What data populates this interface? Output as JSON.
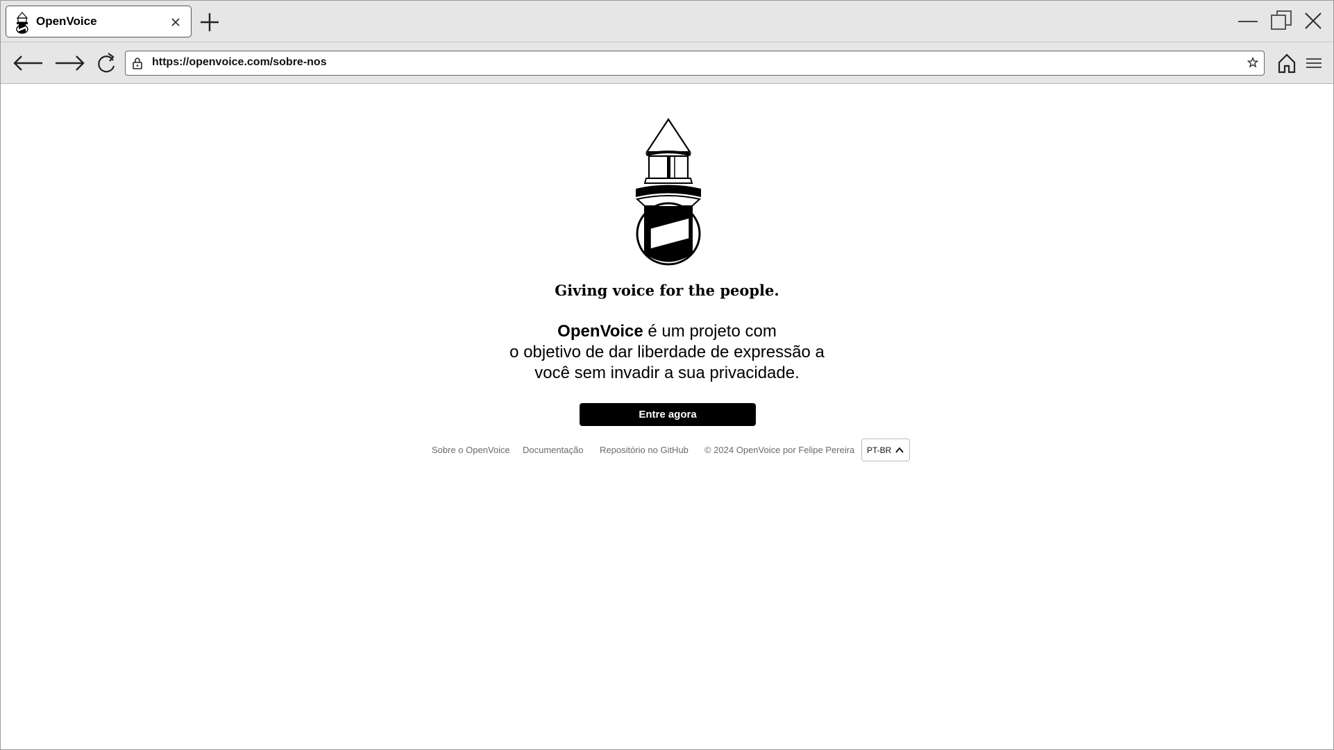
{
  "browser": {
    "tab": {
      "title": "OpenVoice",
      "favicon": "lighthouse-icon"
    },
    "url": "https://openvoice.com/sobre-nos",
    "icons": [
      "back-arrow-icon",
      "forward-arrow-icon",
      "reload-icon",
      "lock-icon",
      "star-icon",
      "home-icon",
      "menu-icon",
      "minimize-icon",
      "maximize-icon",
      "close-icon",
      "plus-icon"
    ]
  },
  "page": {
    "logo": "lighthouse-icon",
    "tagline": "Giving voice for the people.",
    "intro": {
      "brand": "OpenVoice",
      "line1_rest": " é um projeto com",
      "line2": "o objetivo de dar liberdade de expressão a",
      "line3": "você sem invadir a sua privacidade."
    },
    "cta_label": "Entre agora",
    "footer": {
      "about": "Sobre o OpenVoice",
      "docs": "Documentação",
      "repo": "Repositório no GitHub",
      "copyright": "© 2024 OpenVoice por Felipe Pereira",
      "language": "PT-BR"
    }
  },
  "colors": {
    "accent": "#000000",
    "chrome": "#e6e6e6",
    "footer_text": "#6a6a6a"
  }
}
